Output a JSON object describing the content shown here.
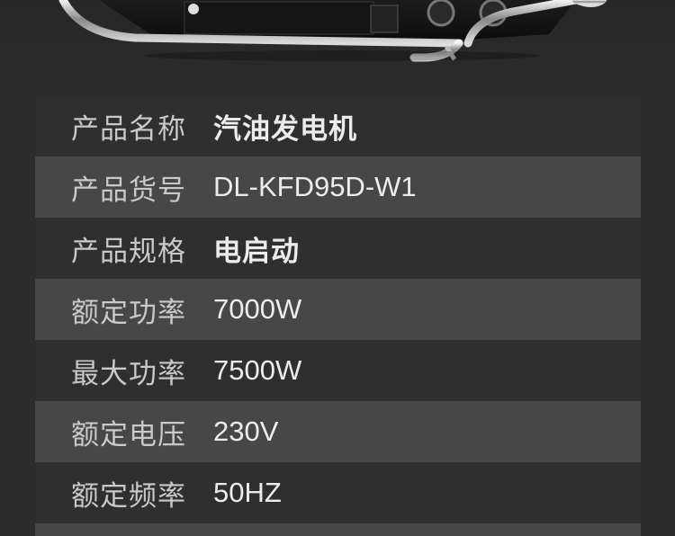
{
  "product_image": {
    "alt": "generator frame"
  },
  "specs": [
    {
      "label": "产品名称",
      "value": "汽油发电机"
    },
    {
      "label": "产品货号",
      "value": "DL-KFD95D-W1"
    },
    {
      "label": "产品规格",
      "value": "电启动"
    },
    {
      "label": "额定功率",
      "value": "7000W"
    },
    {
      "label": "最大功率",
      "value": "7500W"
    },
    {
      "label": "额定电压",
      "value": "230V"
    },
    {
      "label": "额定频率",
      "value": "50HZ"
    }
  ],
  "colors": {
    "background": "#2c2c2c",
    "row_dark": "#2f2f2f",
    "row_light": "#474747",
    "label_text": "#c9c9c9",
    "value_text": "#ececec"
  }
}
